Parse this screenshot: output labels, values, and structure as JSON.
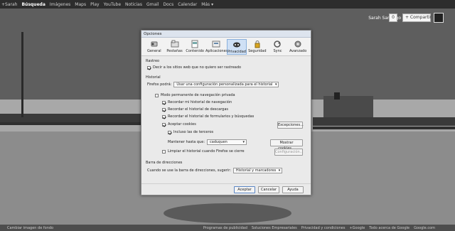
{
  "topbar": {
    "items": [
      "+Sarah",
      "Búsqueda",
      "Imágenes",
      "Maps",
      "Play",
      "YouTube",
      "Noticias",
      "Gmail",
      "Docs",
      "Calendar",
      "Más ▾"
    ]
  },
  "user": {
    "name": "Sarah Santiago",
    "count": "0",
    "share": "+ Compartir"
  },
  "bottom": {
    "left": "Cambiar imagen de fondo",
    "links": [
      "Programas de publicidad",
      "Soluciones Empresariales",
      "Privacidad y condiciones",
      "+Google",
      "Todo acerca de Google",
      "Google.com"
    ]
  },
  "dialog": {
    "title": "Opciones",
    "tabs": [
      {
        "label": "General",
        "icon": "gear-switch-icon"
      },
      {
        "label": "Pestañas",
        "icon": "tabs-icon"
      },
      {
        "label": "Contenido",
        "icon": "content-icon"
      },
      {
        "label": "Aplicaciones",
        "icon": "apps-icon"
      },
      {
        "label": "Privacidad",
        "icon": "mask-icon"
      },
      {
        "label": "Seguridad",
        "icon": "lock-icon"
      },
      {
        "label": "Sync",
        "icon": "sync-icon"
      },
      {
        "label": "Avanzado",
        "icon": "gear-icon"
      }
    ],
    "tracking_title": "Rastreo",
    "tracking_label": "Decir a los sitios web que no quiero ser rastreado",
    "history_title": "Historial",
    "firefox_will": "Firefox podrá:",
    "history_mode": "Usar una configuración personalizada para el historial",
    "private_mode": "Modo permanente de navegación privada",
    "remember_nav": "Recordar mi historial de navegación",
    "remember_downloads": "Recordar el historial de descargas",
    "remember_forms": "Recordar el historial de formularios y búsquedas",
    "accept_cookies": "Aceptar cookies",
    "exceptions": "Excepciones...",
    "third_party": "Incluso las de terceros",
    "keep_until": "Mantener hasta que:",
    "keep_value": "caduquen",
    "show_cookies": "Mostrar cookies...",
    "clear_on_close": "Limpiar el historial cuando Firefox se cierre",
    "config": "Configuración...",
    "address_title": "Barra de direcciones",
    "address_label": "Cuando se use la barra de direcciones, sugerir:",
    "address_value": "Historial y marcadores",
    "ok": "Aceptar",
    "cancel": "Cancelar",
    "help": "Ayuda"
  }
}
